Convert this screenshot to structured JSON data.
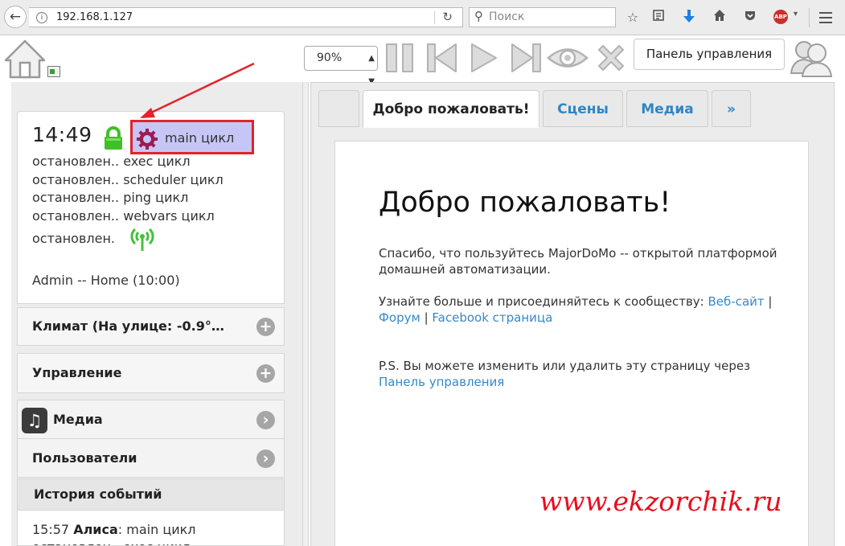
{
  "browser": {
    "url": "192.168.1.127",
    "search_placeholder": "Поиск",
    "adblock_label": "ABP"
  },
  "header": {
    "zoom_value": "90%",
    "control_panel_button": "Панель управления"
  },
  "status": {
    "time": "14:49",
    "main_cycle": "main цикл",
    "cycles": [
      {
        "state": "остановлен..",
        "name": "exec цикл"
      },
      {
        "state": "остановлен..",
        "name": "scheduler цикл"
      },
      {
        "state": "остановлен..",
        "name": "ping цикл"
      },
      {
        "state": "остановлен..",
        "name": "webvars цикл"
      },
      {
        "state": "остановлен.",
        "name": ""
      }
    ],
    "admin_line": "Admin -- Home (10:00)"
  },
  "sidebar": {
    "items": [
      {
        "label": "Климат (На улице: -0.9°…"
      },
      {
        "label": "Управление"
      },
      {
        "label": "Медиа"
      },
      {
        "label": "Пользователи"
      }
    ],
    "history_title": "История событий",
    "history": [
      {
        "time": "15:57",
        "user": "Алиса",
        "text": ": main цикл"
      },
      {
        "time": "",
        "user": "",
        "text": "остановлен.. exec цикл"
      }
    ]
  },
  "tabs": [
    {
      "label": ""
    },
    {
      "label": "Добро пожаловать!"
    },
    {
      "label": "Сцены"
    },
    {
      "label": "Медиа"
    },
    {
      "label": "»"
    }
  ],
  "content": {
    "title": "Добро пожаловать!",
    "para1_line1": "Спасибо, что пользуйтесь MajorDoMo -- открытой платформой",
    "para1_line2": "домашней автоматизации.",
    "para2_text": "Узнайте больше и присоединяйтесь к сообществу: ",
    "link_website": "Веб-сайт",
    "sep1": " |",
    "link_forum": "Форум",
    "sep2": " | ",
    "link_facebook": "Facebook страница",
    "para3_line1": "P.S. Вы можете изменить или удалить эту страницу через",
    "link_panel": "Панель управления"
  },
  "watermark": "www.ekzorchik.ru",
  "colors": {
    "accent_link": "#3788c9",
    "highlight_border": "#e3232b",
    "highlight_fill": "#c6c6f6",
    "watermark": "#e60f1e",
    "lock_green": "#3fbf2a"
  }
}
